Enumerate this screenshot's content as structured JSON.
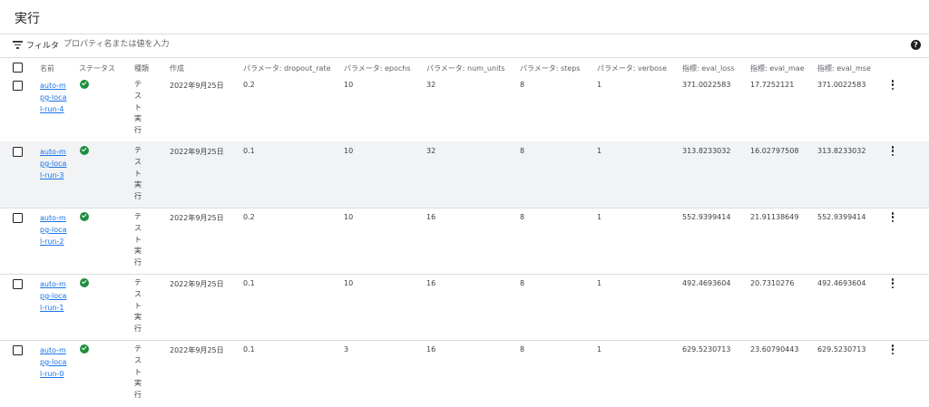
{
  "page": {
    "title": "実行"
  },
  "filter": {
    "label": "フィルタ",
    "placeholder": "プロパティ名または値を入力"
  },
  "help_icon": "?",
  "columns": {
    "name": "名前",
    "status": "ステータス",
    "type": "種類",
    "created": "作成",
    "dropout_rate": "パラメータ: dropout_rate",
    "epochs": "パラメータ: epochs",
    "num_units": "パラメータ: num_units",
    "steps": "パラメータ: steps",
    "verbose": "パラメータ: verbose",
    "eval_loss": "指標: eval_loss",
    "eval_mae": "指標: eval_mae",
    "eval_mse": "指標: eval_mse"
  },
  "status_colors": {
    "success": "#1e8e3e",
    "link": "#1a73e8"
  },
  "rows": [
    {
      "name": "auto-mpg-local-run-4",
      "status": "success",
      "type": "テスト実行",
      "created": "2022年9月25日",
      "dropout_rate": "0.2",
      "epochs": "10",
      "num_units": "32",
      "steps": "8",
      "verbose": "1",
      "eval_loss": "371.0022583",
      "eval_mae": "17.7252121",
      "eval_mse": "371.0022583",
      "highlighted": false
    },
    {
      "name": "auto-mpg-local-run-3",
      "status": "success",
      "type": "テスト実行",
      "created": "2022年9月25日",
      "dropout_rate": "0.1",
      "epochs": "10",
      "num_units": "32",
      "steps": "8",
      "verbose": "1",
      "eval_loss": "313.8233032",
      "eval_mae": "16.02797508",
      "eval_mse": "313.8233032",
      "highlighted": true
    },
    {
      "name": "auto-mpg-local-run-2",
      "status": "success",
      "type": "テスト実行",
      "created": "2022年9月25日",
      "dropout_rate": "0.2",
      "epochs": "10",
      "num_units": "16",
      "steps": "8",
      "verbose": "1",
      "eval_loss": "552.9399414",
      "eval_mae": "21.91138649",
      "eval_mse": "552.9399414",
      "highlighted": false
    },
    {
      "name": "auto-mpg-local-run-1",
      "status": "success",
      "type": "テスト実行",
      "created": "2022年9月25日",
      "dropout_rate": "0.1",
      "epochs": "10",
      "num_units": "16",
      "steps": "8",
      "verbose": "1",
      "eval_loss": "492.4693604",
      "eval_mae": "20.7310276",
      "eval_mse": "492.4693604",
      "highlighted": false
    },
    {
      "name": "auto-mpg-local-run-0",
      "status": "success",
      "type": "テスト実行",
      "created": "2022年9月25日",
      "dropout_rate": "0.1",
      "epochs": "3",
      "num_units": "16",
      "steps": "8",
      "verbose": "1",
      "eval_loss": "629.5230713",
      "eval_mae": "23.60790443",
      "eval_mse": "629.5230713",
      "highlighted": false
    }
  ]
}
